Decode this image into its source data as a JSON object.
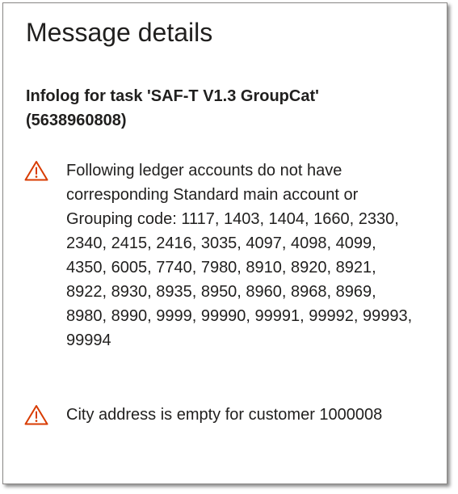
{
  "panel": {
    "title": "Message details",
    "subtitle": "Infolog for task 'SAF-T V1.3 GroupCat' (5638960808)"
  },
  "messages": [
    {
      "severity": "warning",
      "icon": "warning-triangle-icon",
      "text": "Following ledger accounts do not have corresponding Standard main account or Grouping code: 1117, 1403, 1404, 1660, 2330, 2340, 2415, 2416, 3035, 4097, 4098, 4099, 4350, 6005, 7740, 7980, 8910, 8920, 8921, 8922, 8930, 8935, 8950, 8960, 8968, 8969, 8980, 8990, 9999, 99990, 99991, 99992, 99993, 99994"
    },
    {
      "severity": "warning",
      "icon": "warning-triangle-icon",
      "text": "City address is empty for customer 1000008"
    }
  ],
  "colors": {
    "warning": "#d83b01",
    "text": "#201f1e",
    "border": "#8a8886"
  }
}
